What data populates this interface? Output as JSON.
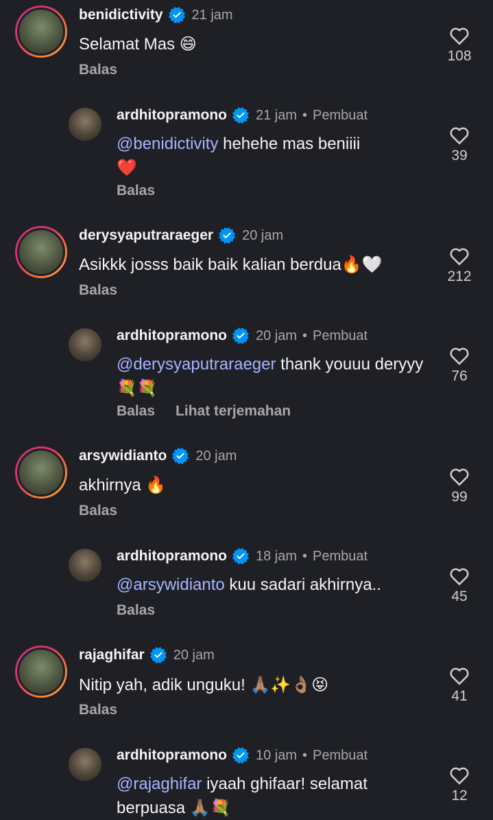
{
  "comments": [
    {
      "username": "benidictivity",
      "time": "21 jam",
      "text": "Selamat Mas",
      "emoji": "😄",
      "reply_label": "Balas",
      "likes": "108"
    },
    {
      "username": "ardhitopramono",
      "time": "21 jam",
      "creator_label": "Pembuat",
      "mention": "@benidictivity",
      "text": " hehehe mas beniiii",
      "emoji": "❤️",
      "reply_label": "Balas",
      "likes": "39"
    },
    {
      "username": "derysyaputraraeger",
      "time": "20 jam",
      "text": "Asikkk josss baik baik kalian berdua",
      "emoji": "🔥🤍",
      "reply_label": "Balas",
      "likes": "212"
    },
    {
      "username": "ardhitopramono",
      "time": "20 jam",
      "creator_label": "Pembuat",
      "mention": "@derysyaputraraeger",
      "text": " thank youuu deryyy ",
      "emoji": "💐💐",
      "reply_label": "Balas",
      "translate_label": "Lihat terjemahan",
      "likes": "76"
    },
    {
      "username": "arsywidianto",
      "time": "20 jam",
      "text": "akhirnya ",
      "emoji": "🔥",
      "reply_label": "Balas",
      "likes": "99"
    },
    {
      "username": "ardhitopramono",
      "time": "18 jam",
      "creator_label": "Pembuat",
      "mention": "@arsywidianto",
      "text": " kuu sadari akhirnya..",
      "reply_label": "Balas",
      "likes": "45"
    },
    {
      "username": "rajaghifar",
      "time": "20 jam",
      "text": "Nitip yah, adik unguku! ",
      "emoji": "🙏🏽✨👌🏽😝",
      "reply_label": "Balas",
      "likes": "41"
    },
    {
      "username": "ardhitopramono",
      "time": "10 jam",
      "creator_label": "Pembuat",
      "mention": "@rajaghifar",
      "text": " iyaah ghifaar! selamat berpuasa ",
      "emoji": "🙏🏽💐",
      "likes": "12"
    }
  ],
  "icons": {
    "verified": "verified-badge-icon",
    "like": "heart-icon",
    "avatar": "profile-picture"
  },
  "colors": {
    "background": "#1f2026",
    "mention": "#a8b4ff",
    "verified": "#0095f6",
    "muted": "#a8a8a8"
  }
}
